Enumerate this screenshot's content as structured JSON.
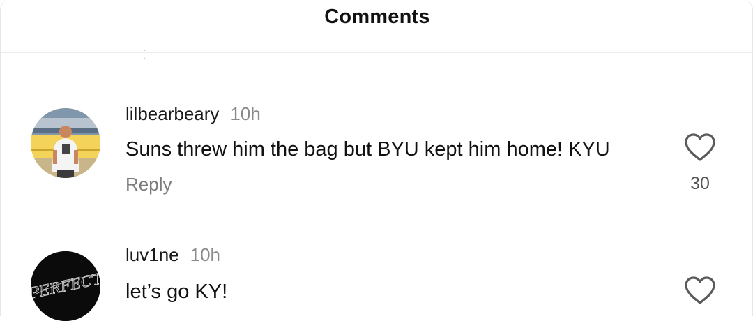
{
  "header": {
    "title": "Comments"
  },
  "comments": [
    {
      "username": "lilbearbeary",
      "time": "10h",
      "text": "Suns threw him the bag but BYU kept him home! KYU",
      "reply_label": "Reply",
      "likes": "30",
      "avatar_icon": "profile-photo-icon"
    },
    {
      "username": "luv1ne",
      "time": "10h",
      "text": "let’s go KY!",
      "avatar_icon": "logo-avatar-icon",
      "avatar_logo_text": "PERFECT"
    }
  ],
  "icons": {
    "like": "heart-outline-icon"
  },
  "colors": {
    "text": "#111111",
    "muted": "#8a8a8a",
    "reply": "#7c7c7c",
    "divider": "#ececec"
  }
}
